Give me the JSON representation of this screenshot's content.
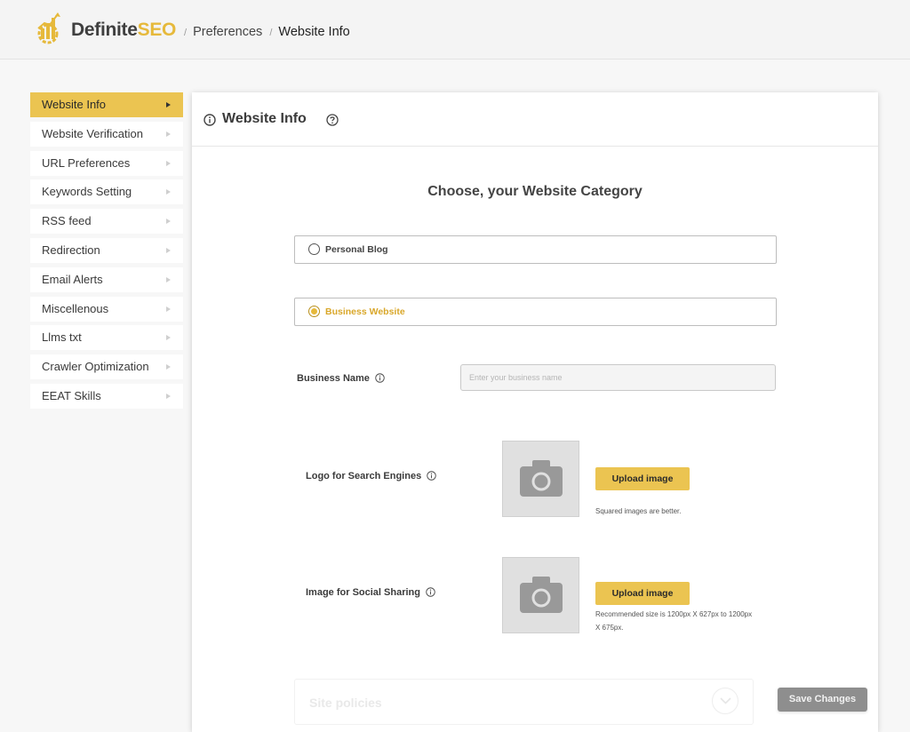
{
  "header": {
    "brand_part1": "Definite",
    "brand_part2": "SEO",
    "breadcrumb": [
      "Preferences",
      "Website Info"
    ]
  },
  "sidebar": {
    "items": [
      {
        "label": "Website Info",
        "active": true
      },
      {
        "label": "Website Verification",
        "active": false
      },
      {
        "label": "URL Preferences",
        "active": false
      },
      {
        "label": "Keywords Setting",
        "active": false
      },
      {
        "label": "RSS feed",
        "active": false
      },
      {
        "label": "Redirection",
        "active": false
      },
      {
        "label": "Email Alerts",
        "active": false
      },
      {
        "label": "Miscellenous",
        "active": false
      },
      {
        "label": "Llms txt",
        "active": false
      },
      {
        "label": "Crawler Optimization",
        "active": false
      },
      {
        "label": "EEAT Skills",
        "active": false
      }
    ]
  },
  "panel": {
    "title": "Website Info",
    "heading": "Choose, your Website Category",
    "options": [
      {
        "label": "Personal Blog",
        "selected": false
      },
      {
        "label": "Business Website",
        "selected": true
      }
    ],
    "business_name_label": "Business Name",
    "business_name_placeholder": "Enter your business name",
    "business_name_value": "",
    "logo_label": "Logo for Search Engines",
    "logo_hint": "Squared images are better.",
    "social_label": "Image for Social Sharing",
    "social_hint": "Recommended size is 1200px X 627px to 1200px X 675px.",
    "upload_label": "Upload image",
    "policies_label": "Site policies",
    "save_label": "Save Changes"
  },
  "colors": {
    "accent": "#ebc451",
    "brand_gold": "#e6b93b",
    "save_button": "#8e8e8e"
  }
}
